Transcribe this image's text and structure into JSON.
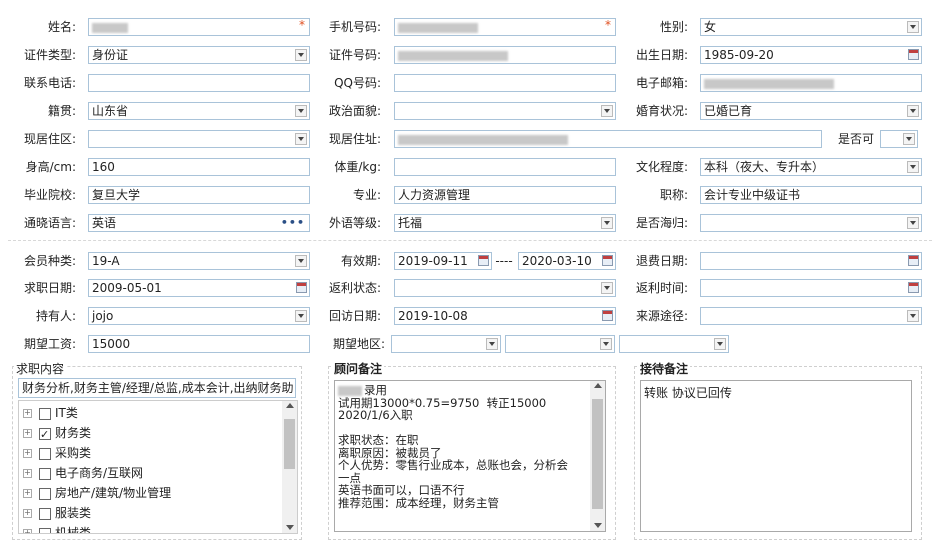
{
  "row1": {
    "name_label": "姓名:",
    "mobile_label": "手机号码:",
    "gender_label": "性别:",
    "gender_value": "女",
    "req_mark": "*"
  },
  "row2": {
    "idtype_label": "证件类型:",
    "idtype_value": "身份证",
    "idno_label": "证件号码:",
    "birth_label": "出生日期:",
    "birth_value": "1985-09-20"
  },
  "row3": {
    "tel_label": "联系电话:",
    "qq_label": "QQ号码:",
    "email_label": "电子邮箱:"
  },
  "row4": {
    "native_label": "籍贯:",
    "native_value": "山东省",
    "political_label": "政治面貌:",
    "marital_label": "婚育状况:",
    "marital_value": "已婚已育"
  },
  "row5": {
    "region_label": "现居住区:",
    "address_label": "现居住址:",
    "yesno_label": "是否可"
  },
  "row6": {
    "height_label": "身高/cm:",
    "height_value": "160",
    "weight_label": "体重/kg:",
    "edu_label": "文化程度:",
    "edu_value": "本科（夜大、专升本）"
  },
  "row7": {
    "school_label": "毕业院校:",
    "school_value": "复旦大学",
    "major_label": "专业:",
    "major_value": "人力资源管理",
    "title_label": "职称:",
    "title_value": "会计专业中级证书"
  },
  "row8": {
    "lang_label": "通晓语言:",
    "lang_value": "英语",
    "lang_more": "•••",
    "flevel_label": "外语等级:",
    "flevel_value": "托福",
    "returnee_label": "是否海归:"
  },
  "row9": {
    "member_label": "会员种类:",
    "member_value": "19-A",
    "valid_label": "有效期:",
    "valid_from": "2019-09-11",
    "valid_sep": "----",
    "valid_to": "2020-03-10",
    "refund_label": "退费日期:"
  },
  "row10": {
    "jobdate_label": "求职日期:",
    "jobdate_value": "2009-05-01",
    "rebate_label": "返利状态:",
    "rebatetime_label": "返利时间:"
  },
  "row11": {
    "holder_label": "持有人:",
    "holder_value": "jojo",
    "visit_label": "回访日期:",
    "visit_value": "2019-10-08",
    "source_label": "来源途径:"
  },
  "row12": {
    "salary_label": "期望工资:",
    "salary_value": "15000",
    "area_label": "期望地区:"
  },
  "job_panel": {
    "title": "求职内容",
    "summary": "财务分析,财务主管/经理/总监,成本会计,出纳财务助",
    "tree": [
      {
        "label": "IT类",
        "checked": false
      },
      {
        "label": "财务类",
        "checked": true
      },
      {
        "label": "采购类",
        "checked": false
      },
      {
        "label": "电子商务/互联网",
        "checked": false
      },
      {
        "label": "房地产/建筑/物业管理",
        "checked": false
      },
      {
        "label": "服装类",
        "checked": false
      },
      {
        "label": "机械类",
        "checked": false
      }
    ]
  },
  "advisor_panel": {
    "title": "顾问备注",
    "lines": [
      "录用",
      "试用期13000*0.75=9750  转正15000",
      "2020/1/6入职",
      "",
      "求职状态：在职",
      "离职原因：被裁员了",
      "个人优势：零售行业成本，总账也会，分析会",
      "一点",
      "英语书面可以，口语不行",
      "推荐范围：成本经理，财务主管"
    ]
  },
  "reception_panel": {
    "title": "接待备注",
    "text": "转账 协议已回传"
  },
  "icons": {
    "dropdown": "chevron-down-icon",
    "calendar": "calendar-icon",
    "tree_expand": "plus-icon"
  },
  "colors": {
    "input_border": "#a9c3d9",
    "required": "#e05020",
    "link_dots": "#2b4f86"
  }
}
